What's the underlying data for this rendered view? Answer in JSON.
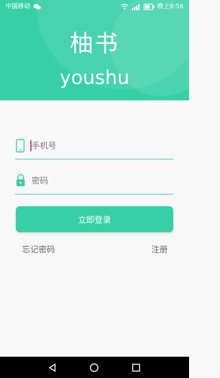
{
  "status_bar": {
    "carrier": "中国移动",
    "time": "晚上8:56"
  },
  "app": {
    "title": "柚书",
    "subtitle": "youshu",
    "accent_color": "#37d0a6"
  },
  "form": {
    "phone": {
      "placeholder": "手机号",
      "value": "",
      "icon": "phone-icon"
    },
    "password": {
      "placeholder": "密码",
      "value": "",
      "icon": "lock-icon"
    },
    "login_button": "立即登录"
  },
  "links": {
    "forgot_password": "忘记密码",
    "register": "注册"
  },
  "navbar": {
    "icons": [
      "back-icon",
      "home-icon",
      "recents-icon"
    ]
  }
}
